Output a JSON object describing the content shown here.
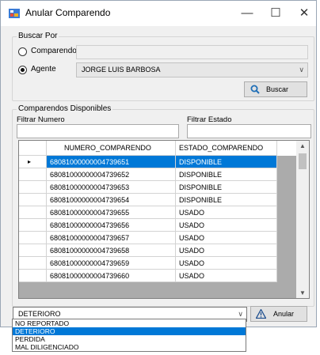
{
  "window": {
    "title": "Anular Comparendo",
    "controls": {
      "minimize": "—",
      "maximize": "☐",
      "close": "✕"
    }
  },
  "buscar": {
    "group_label": "Buscar Por",
    "comparendo_label": "Comparendo",
    "comparendo_value": "",
    "agente_label": "Agente",
    "agente_selected": "JORGE LUIS BARBOSA",
    "agente_checked": true,
    "search_button": "Buscar"
  },
  "disponibles": {
    "group_label": "Comparendos Disponibles",
    "filter_numero_label": "Filtrar Numero",
    "filter_numero_value": "",
    "filter_estado_label": "Filtrar Estado",
    "filter_estado_value": ""
  },
  "table": {
    "columns": [
      "NUMERO_COMPARENDO",
      "ESTADO_COMPARENDO"
    ],
    "selected_row": 0,
    "rows": [
      [
        "68081000000004739651",
        "DISPONIBLE"
      ],
      [
        "68081000000004739652",
        "DISPONIBLE"
      ],
      [
        "68081000000004739653",
        "DISPONIBLE"
      ],
      [
        "68081000000004739654",
        "DISPONIBLE"
      ],
      [
        "68081000000004739655",
        "USADO"
      ],
      [
        "68081000000004739656",
        "USADO"
      ],
      [
        "68081000000004739657",
        "USADO"
      ],
      [
        "68081000000004739658",
        "USADO"
      ],
      [
        "68081000000004739659",
        "USADO"
      ],
      [
        "68081000000004739660",
        "USADO"
      ]
    ]
  },
  "estado_combo": {
    "selected": "DETERIORO",
    "options": [
      "NO REPORTADO",
      "DETERIORO",
      "PERDIDA",
      "MAL DILIGENCIADO"
    ]
  },
  "anular_button": "Anular",
  "colors": {
    "selection": "#0078d7",
    "grid_background": "#ababab",
    "window_background": "#f0f0f0"
  }
}
